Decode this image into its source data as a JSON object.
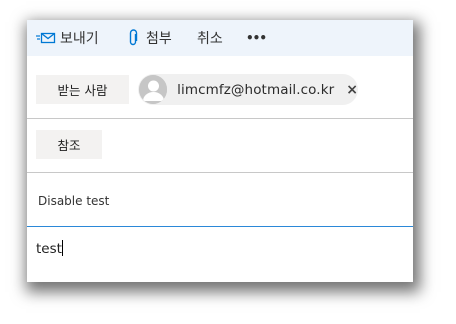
{
  "toolbar": {
    "send_label": "보내기",
    "send_icon": "send-mail-icon",
    "attach_label": "첨부",
    "attach_icon": "paperclip-icon",
    "discard_label": "취소",
    "more_label": "•••",
    "accent": "#0078d4"
  },
  "to": {
    "button_label": "받는 사람",
    "recipient_email": "limcmfz@hotmail.co.kr",
    "remove_label": "×"
  },
  "cc": {
    "button_label": "참조"
  },
  "subject": {
    "value": "Disable test"
  },
  "body": {
    "value": "test"
  }
}
